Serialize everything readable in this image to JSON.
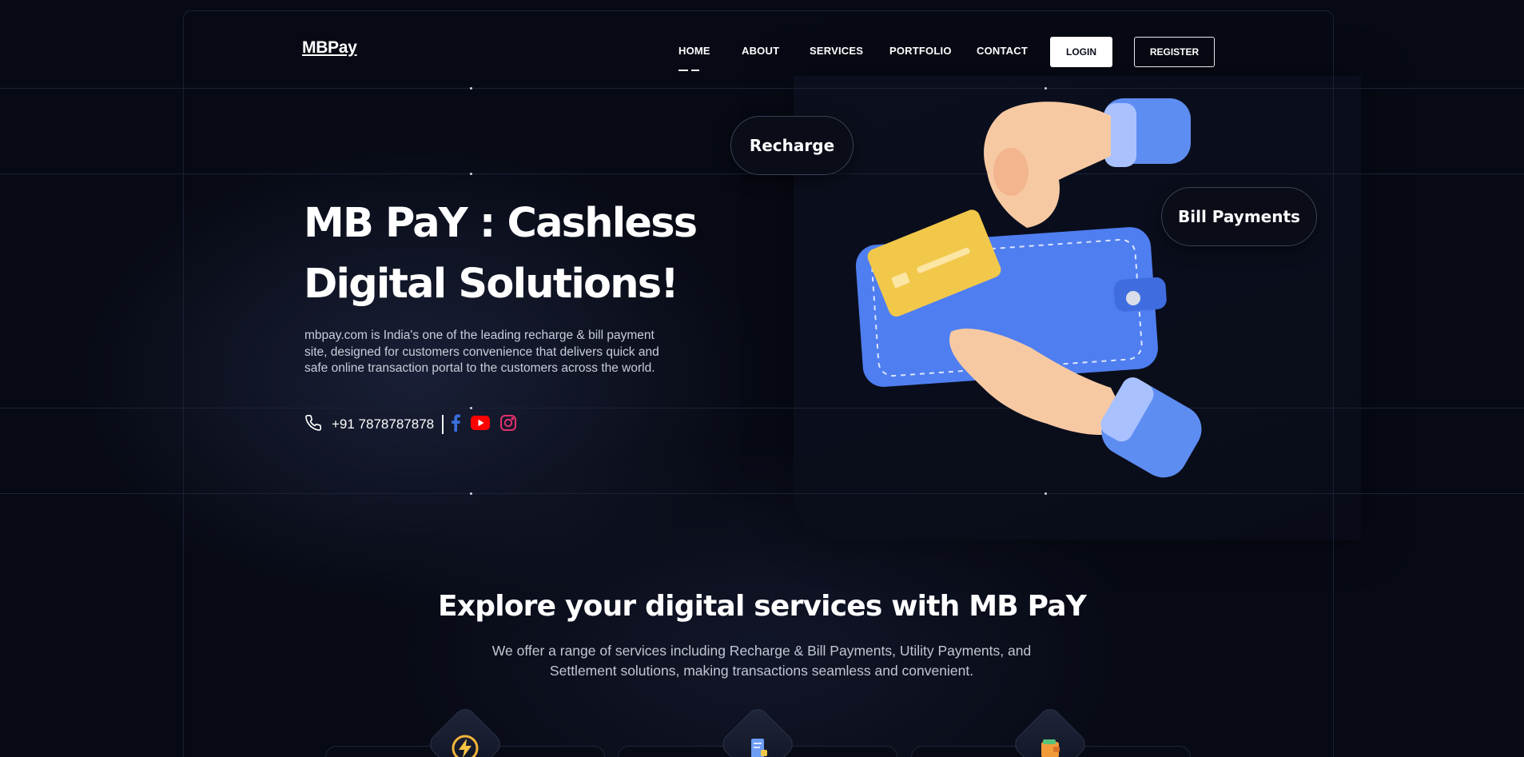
{
  "header": {
    "logo": "MBPay",
    "nav": [
      {
        "label": "HOME",
        "active": true
      },
      {
        "label": "ABOUT"
      },
      {
        "label": "SERVICES"
      },
      {
        "label": "PORTFOLIO"
      },
      {
        "label": "CONTACT"
      }
    ],
    "login_label": "LOGIN",
    "register_label": "REGISTER"
  },
  "hero": {
    "title_line1": "MB PaY : Cashless",
    "title_line2": "Digital Solutions!",
    "description": "mbpay.com is India's one of the leading recharge & bill payment site, designed for customers convenience that delivers quick and safe online transaction portal to the customers across the world.",
    "phone": "+91 7878787878",
    "tag_recharge": "Recharge",
    "tag_bill": "Bill Payments"
  },
  "services": {
    "title": "Explore your digital services with MB PaY",
    "description": "We offer a range of services including Recharge & Bill Payments, Utility Payments, and Settlement solutions, making transactions seamless and convenient.",
    "icons": [
      "recharge-bolt-icon",
      "bill-receipt-icon",
      "wallet-icon"
    ]
  },
  "colors": {
    "background": "#070a14",
    "facebook": "#3b6fe0",
    "youtube": "#ff0000",
    "instagram": "#e1306c",
    "card_blue": "#4f7ef0",
    "card_yellow": "#f2c84b"
  }
}
